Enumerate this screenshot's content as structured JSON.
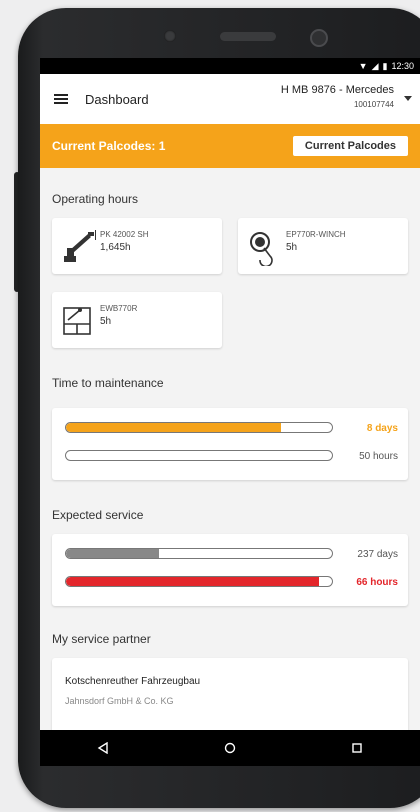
{
  "status": {
    "time": "12:30"
  },
  "header": {
    "title": "Dashboard",
    "vehicle_name": "H MB 9876 - Mercedes",
    "vehicle_number": "100107744"
  },
  "palcodes": {
    "label": "Current Palcodes: 1",
    "button": "Current Palcodes"
  },
  "operating_hours": {
    "title": "Operating hours",
    "cards": [
      {
        "code": "PK 42002 SH",
        "hours": "1,645h",
        "icon": "crane-arm-icon"
      },
      {
        "code": "EP770R-WINCH",
        "hours": "5h",
        "icon": "winch-hook-icon"
      },
      {
        "code": "EWB770R",
        "hours": "5h",
        "icon": "body-frame-icon"
      }
    ]
  },
  "maintenance": {
    "title": "Time to maintenance",
    "bars": [
      {
        "label": "8 days",
        "fill": 0.81,
        "color": "#f5a31a"
      },
      {
        "label": "50 hours",
        "fill": 0.0,
        "color": "#f5a31a"
      }
    ]
  },
  "service": {
    "title": "Expected service",
    "bars": [
      {
        "label": "237 days",
        "fill": 0.35,
        "color": "#888888"
      },
      {
        "label": "66 hours",
        "fill": 0.95,
        "color": "#e3262b"
      }
    ]
  },
  "partner": {
    "title": "My service partner",
    "name": "Kotschenreuther Fahrzeugbau",
    "company": "Jahnsdorf GmbH & Co. KG"
  },
  "colors": {
    "accent": "#f5a31a",
    "alert": "#e3262b"
  }
}
